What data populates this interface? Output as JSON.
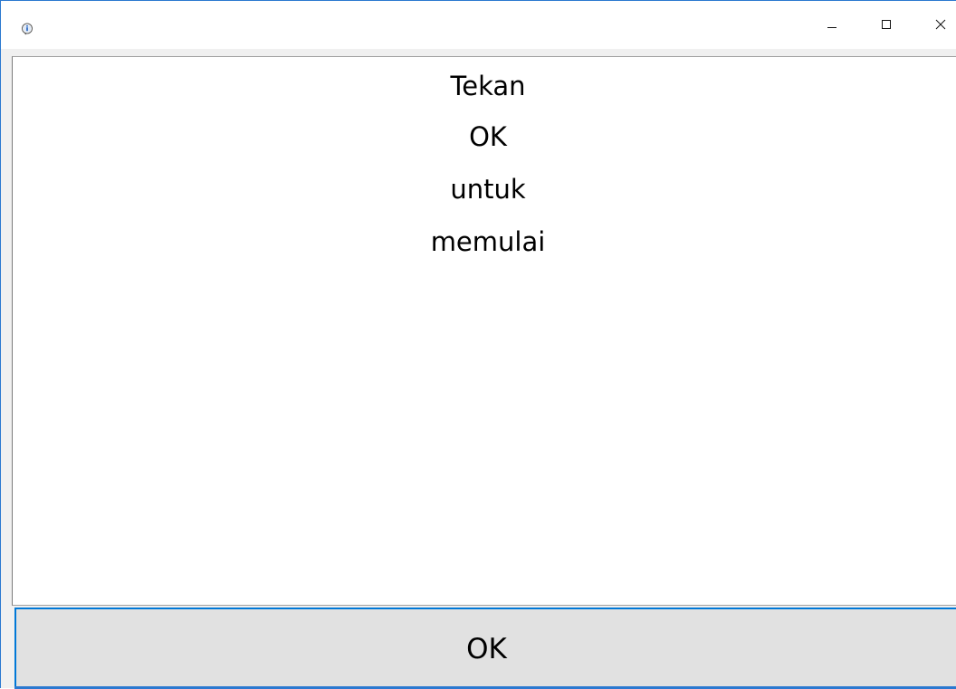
{
  "window": {
    "title": "",
    "icon": "info-icon",
    "controls": {
      "minimize": "minimize-icon",
      "maximize": "maximize-icon",
      "close": "close-icon"
    }
  },
  "message": {
    "lines": [
      "Tekan",
      "OK",
      "untuk",
      "memulai"
    ]
  },
  "ok_button": {
    "label": "OK"
  },
  "colors": {
    "accent": "#0078d7",
    "button_bg": "#e1e1e1",
    "window_border": "#2b79d0"
  }
}
